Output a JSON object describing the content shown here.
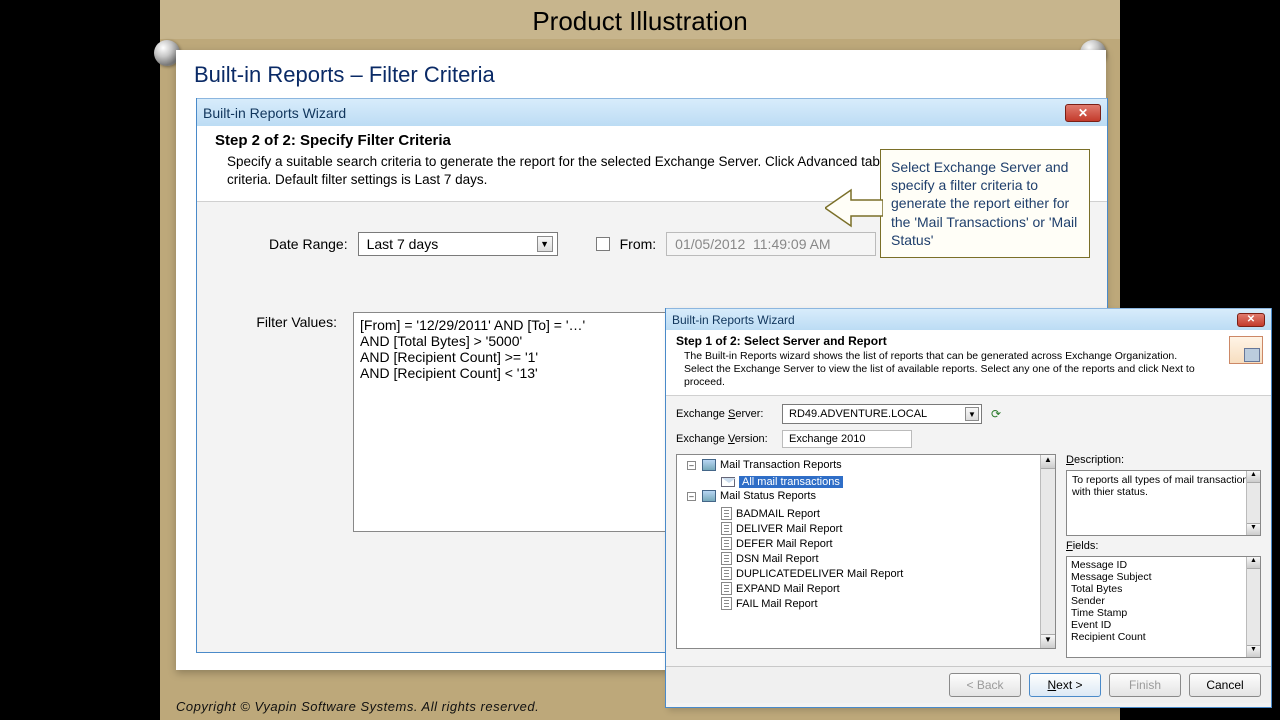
{
  "page_title": "Product Illustration",
  "subtitle": "Built-in Reports – Filter Criteria",
  "wizard2": {
    "title": "Built-in Reports Wizard",
    "step_title": "Step 2 of 2:  Specify Filter Criteria",
    "step_desc": "Specify a suitable search criteria to generate the report for the selected Exchange Server. Click Advanced tab to construct complex search criteria. Default filter settings is Last 7 days.",
    "date_range_label": "Date Range:",
    "date_range_value": "Last 7 days",
    "from_label": "From:",
    "from_value": "01/05/2012  11:49:09 AM",
    "filter_values_label": "Filter Values:",
    "filter_values_text": "[From] = '12/29/2011' AND [To] = '…'\nAND [Total Bytes] > '5000'\nAND [Recipient Count] >= '1'\nAND [Recipient Count] < '13'"
  },
  "callout_text": "Select Exchange Server and specify a filter criteria to generate the report either for the 'Mail Transactions' or 'Mail  Status'",
  "wizard1": {
    "title": "Built-in Reports Wizard",
    "step_title": "Step 1 of 2:  Select Server and Report",
    "step_desc": "The Built-in Reports wizard shows the list of reports that can be generated across Exchange Organization. Select the Exchange Server to view the list of available reports. Select any one of the reports and click Next to proceed.",
    "exchange_server_label": "Exchange Server:",
    "exchange_server_value": "RD49.ADVENTURE.LOCAL",
    "exchange_version_label": "Exchange Version:",
    "exchange_version_value": "Exchange 2010",
    "tree": {
      "group1": "Mail Transaction Reports",
      "group1_item": "All mail transactions",
      "group2": "Mail Status Reports",
      "group2_items": [
        "BADMAIL Report",
        "DELIVER Mail Report",
        "DEFER Mail Report",
        "DSN Mail Report",
        "DUPLICATEDELIVER Mail Report",
        "EXPAND Mail Report",
        "FAIL Mail Report"
      ]
    },
    "description_label": "Description:",
    "description_text": "To reports all types of mail transaction with thier status.",
    "fields_label": "Fields:",
    "fields": [
      "Message ID",
      "Message Subject",
      "Total Bytes",
      "Sender",
      "Time Stamp",
      "Event ID",
      "Recipient Count"
    ],
    "buttons": {
      "back": "< Back",
      "next": "Next >",
      "finish": "Finish",
      "cancel": "Cancel"
    }
  },
  "copyright": "Copyright © Vyapin Software Systems. All rights reserved."
}
